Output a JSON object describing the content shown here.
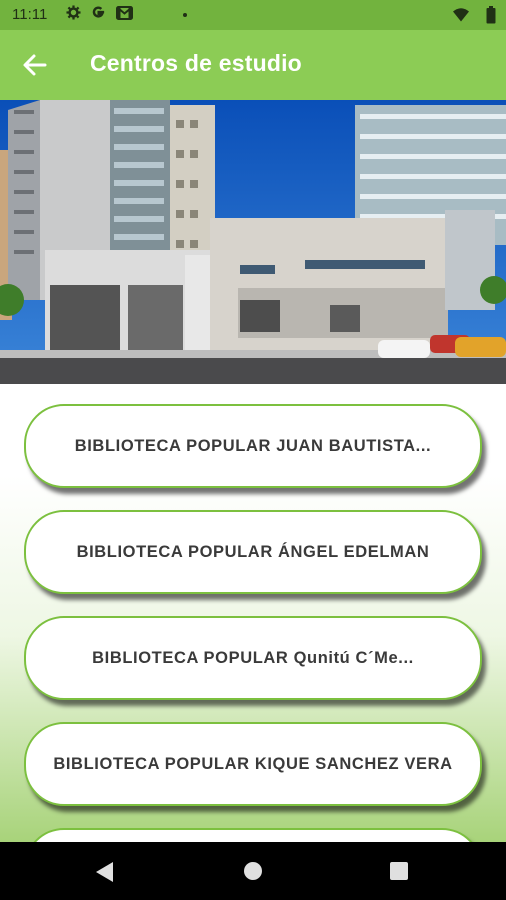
{
  "status": {
    "time": "11:11"
  },
  "app_bar": {
    "title": "Centros de estudio"
  },
  "libraries": [
    "BIBLIOTECA POPULAR JUAN BAUTISTA...",
    "BIBLIOTECA POPULAR ÁNGEL EDELMAN",
    "BIBLIOTECA POPULAR  Qunitú C´Me...",
    "BIBLIOTECA POPULAR KIQUE SANCHEZ VERA",
    ""
  ],
  "colors": {
    "status_bar": "#72b33e",
    "app_bar": "#8ccc55",
    "card_border": "#7cc03f"
  }
}
